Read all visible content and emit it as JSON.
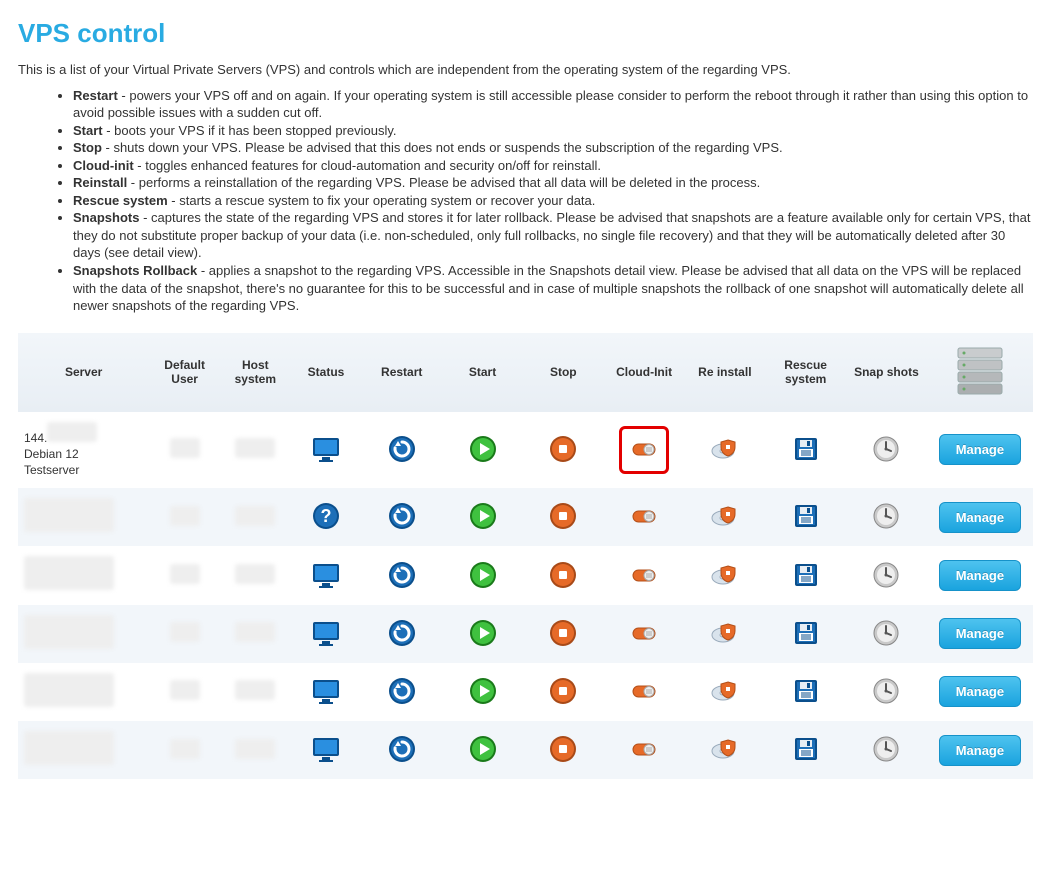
{
  "title": "VPS control",
  "intro": "This is a list of your Virtual Private Servers (VPS) and controls which are independent from the operating system of the regarding VPS.",
  "info": [
    {
      "label": "Restart",
      "text": " - powers your VPS off and on again. If your operating system is still accessible please consider to perform the reboot through it rather than using this option to avoid possible issues with a sudden cut off."
    },
    {
      "label": "Start",
      "text": " - boots your VPS if it has been stopped previously."
    },
    {
      "label": "Stop",
      "text": " - shuts down your VPS. Please be advised that this does not ends or suspends the subscription of the regarding VPS."
    },
    {
      "label": "Cloud-init",
      "text": " - toggles enhanced features for cloud-automation and security on/off for reinstall."
    },
    {
      "label": "Reinstall",
      "text": " - performs a reinstallation of the regarding VPS. Please be advised that all data will be deleted in the process."
    },
    {
      "label": "Rescue system",
      "text": " - starts a rescue system to fix your operating system or recover your data."
    },
    {
      "label": "Snapshots",
      "text": " - captures the state of the regarding VPS and stores it for later rollback. Please be advised that snapshots are a feature available only for certain VPS, that they do not substitute proper backup of your data (i.e. non-scheduled, only full rollbacks, no single file recovery) and that they will be automatically deleted after 30 days (see detail view)."
    },
    {
      "label": "Snapshots Rollback",
      "text": " - applies a snapshot to the regarding VPS. Accessible in the Snapshots detail view. Please be advised that all data on the VPS will be replaced with the data of the snapshot, there's no guarantee for this to be successful and in case of multiple snapshots the rollback of one snapshot will automatically delete all newer snapshots of the regarding VPS."
    }
  ],
  "columns": {
    "server": "Server",
    "default_user": "Default User",
    "host_system": "Host system",
    "status": "Status",
    "restart": "Restart",
    "start": "Start",
    "stop": "Stop",
    "cloud_init": "Cloud-Init",
    "reinstall": "Re install",
    "rescue": "Rescue system",
    "snapshots": "Snap shots",
    "manage": ""
  },
  "manage_label": "Manage",
  "rows": [
    {
      "server_ip": "144.",
      "server_os": "Debian 12",
      "server_name": "Testserver",
      "status": "running",
      "cloud_init_highlight": true
    },
    {
      "server_ip": "",
      "server_os": "",
      "server_name": "",
      "status": "unknown",
      "cloud_init_highlight": false
    },
    {
      "server_ip": "",
      "server_os": "",
      "server_name": "",
      "status": "running",
      "cloud_init_highlight": false
    },
    {
      "server_ip": "",
      "server_os": "",
      "server_name": "",
      "status": "running",
      "cloud_init_highlight": false
    },
    {
      "server_ip": "",
      "server_os": "",
      "server_name": "",
      "status": "running",
      "cloud_init_highlight": false
    },
    {
      "server_ip": "",
      "server_os": "",
      "server_name": "",
      "status": "running",
      "cloud_init_highlight": false
    }
  ]
}
